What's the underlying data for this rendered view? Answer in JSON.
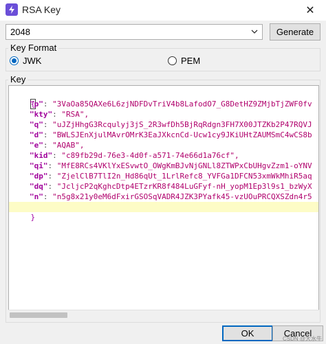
{
  "window": {
    "title": "RSA Key",
    "close_glyph": "✕"
  },
  "key_size": {
    "value": "2048",
    "generate_label": "Generate"
  },
  "key_format": {
    "group_label": "Key Format",
    "options": [
      {
        "label": "JWK",
        "selected": true
      },
      {
        "label": "PEM",
        "selected": false
      }
    ]
  },
  "key_group": {
    "label": "Key"
  },
  "json_text": {
    "open_brace": "{",
    "close_brace": "}",
    "fields": [
      {
        "key": "\"p\"",
        "value": "\"3VaOa85QAXe6L6zjNDFDvTriV4b8LafodO7_G8DetHZ9ZMjbTjZWF0fv"
      },
      {
        "key": "\"kty\"",
        "value": "\"RSA\","
      },
      {
        "key": "\"q\"",
        "value": "\"uJZjHhgG3Rcqulyj3jS_2R3wfDh5BjRqRdgn3FH7X00JTZKb2P47RQVJ"
      },
      {
        "key": "\"d\"",
        "value": "\"BWLSJEnXjulMAvrOMrK3EaJXkcnCd-Ucw1cy9JKiUHtZAUMSmC4wCS8b"
      },
      {
        "key": "\"e\"",
        "value": "\"AQAB\","
      },
      {
        "key": "\"kid\"",
        "value": "\"c89fb29d-76e3-4d0f-a571-74e66d1a76cf\","
      },
      {
        "key": "\"qi\"",
        "value": "\"MfE8RCs4VKlYxESvwtO_OWgKmBJvNjGNLl8ZTWPxCbUHgvZzm1-oYNV"
      },
      {
        "key": "\"dp\"",
        "value": "\"ZjelClB7TlI2n_Hd86qUt_1LrlRefc8_YVFGa1DFCN53xmWkMhiR5aq"
      },
      {
        "key": "\"dq\"",
        "value": "\"JcljcP2qKghcDtp4ETzrKR8f484LuGFyf-nH_yopM1Ep3l9s1_bzWyX"
      },
      {
        "key": "\"n\"",
        "value": "\"n5g8x21y0eM6dFxirGSOSqVADR4JZK3PYafk45-vzUOuPRCQXSZdn4r5"
      }
    ]
  },
  "buttons": {
    "ok_label": "OK",
    "cancel_label": "Cancel"
  },
  "watermark": "CSDN @大水牛",
  "colors": {
    "accent": "#0067c0",
    "json_key": "#a0009b",
    "json_value": "#b0006c",
    "highlight_line": "#fdfcc6"
  },
  "icons": {
    "app": "flash-icon",
    "close": "close-icon",
    "dropdown": "chevron-down-icon"
  }
}
